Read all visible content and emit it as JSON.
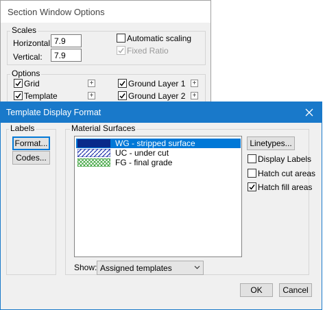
{
  "bg": {
    "title": "Section Window Options",
    "scales_label": "Scales",
    "horizontal_label": "Horizontal:",
    "horizontal_value": "7.9",
    "vertical_label": "Vertical:",
    "vertical_value": "7.9",
    "auto_scaling_label": "Automatic scaling",
    "fixed_ratio_label": "Fixed Ratio",
    "options_label": "Options",
    "grid_label": "Grid",
    "template_label": "Template",
    "ground1_label": "Ground Layer 1",
    "ground2_label": "Ground Layer 2",
    "plus": "+"
  },
  "dialog": {
    "title": "Template Display Format",
    "close_glyph": "✕",
    "labels_group": "Labels",
    "format_button": "Format...",
    "codes_button": "Codes...",
    "material_group": "Material Surfaces",
    "surfaces": [
      {
        "label": "WG - stripped surface"
      },
      {
        "label": "UC - under cut"
      },
      {
        "label": "FG - final grade"
      }
    ],
    "linetypes_button": "Linetypes...",
    "display_labels": "Display Labels",
    "hatch_cut": "Hatch cut areas",
    "hatch_fill": "Hatch fill areas",
    "show_label": "Show:",
    "show_value": "Assigned templates",
    "ok_button": "OK",
    "cancel_button": "Cancel"
  },
  "colors": {
    "accent": "#1979ca",
    "selection": "#0078d7",
    "wg_fill": "#0a2a8a",
    "uc_hatch": "#1a2fa8",
    "fg_hatch": "#2a9a2a"
  }
}
